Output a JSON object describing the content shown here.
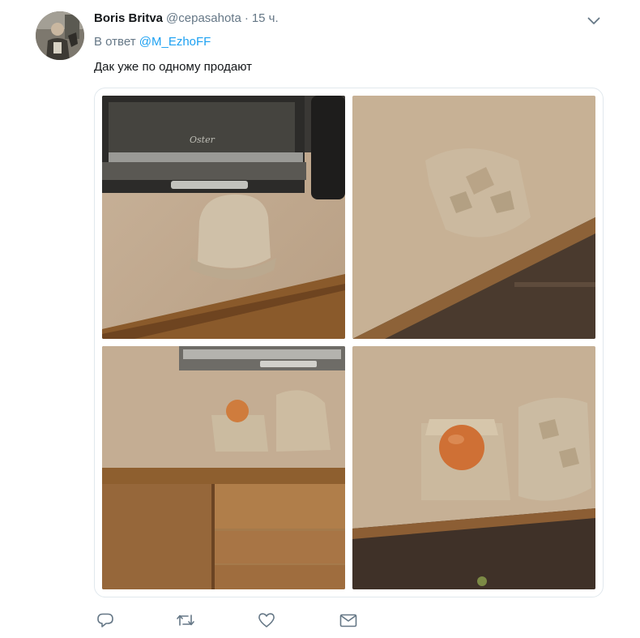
{
  "tweet": {
    "author_name": "Boris Britva",
    "author_handle": "@cepasahota",
    "separator": "·",
    "time": "15 ч.",
    "reply_prefix": "В ответ",
    "reply_mention": "@M_EzhoFF",
    "text": "Дак уже по одному продают",
    "photo_brand_text": "Oster"
  },
  "icons": {
    "avatar": "avatar",
    "caret": "chevron-down-icon",
    "reply": "reply-icon",
    "retweet": "retweet-icon",
    "like": "heart-icon",
    "dm": "envelope-icon"
  },
  "colors": {
    "link": "#1da1f2",
    "secondary_text": "#657786",
    "primary_text": "#14171a",
    "border": "#e1e8ed"
  }
}
